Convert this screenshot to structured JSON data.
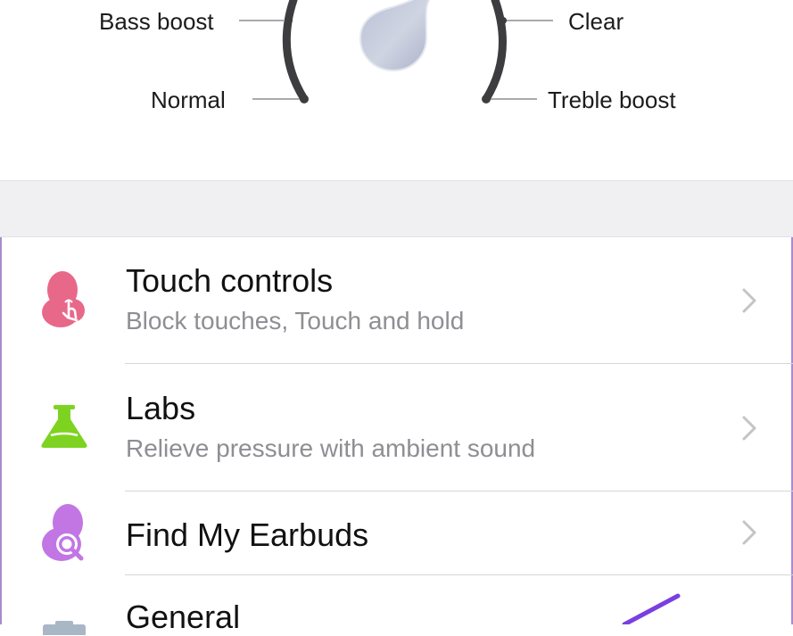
{
  "equalizer": {
    "presets": {
      "bass_boost": "Bass boost",
      "normal": "Normal",
      "clear": "Clear",
      "treble_boost": "Treble boost"
    }
  },
  "settings": {
    "items": [
      {
        "title": "Touch controls",
        "subtitle": "Block touches, Touch and hold",
        "icon": "touch-hand-icon",
        "color": "#e8688a"
      },
      {
        "title": "Labs",
        "subtitle": "Relieve pressure with ambient sound",
        "icon": "flask-icon",
        "color": "#7ed321"
      },
      {
        "title": "Find My Earbuds",
        "subtitle": "",
        "icon": "earbud-search-icon",
        "color": "#c276e3"
      },
      {
        "title": "General",
        "subtitle": "",
        "icon": "general-icon",
        "color": "#a9b6c6"
      }
    ]
  },
  "colors": {
    "annotation_stroke": "#7a3fe0",
    "frame": "#a98bd0"
  }
}
